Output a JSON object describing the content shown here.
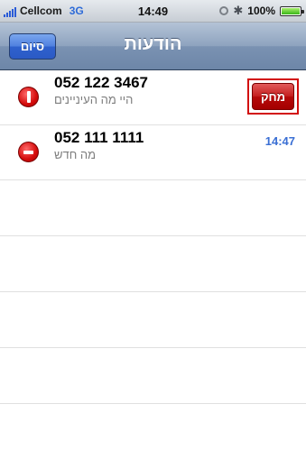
{
  "status_bar": {
    "carrier": "Cellcom",
    "network": "3G",
    "time": "14:49",
    "battery": "100%",
    "battery_level": 1.0,
    "icons": [
      "signal-icon",
      "lock-icon",
      "bluetooth-icon",
      "battery-icon"
    ]
  },
  "nav": {
    "title": "הודעות",
    "done_label": "סיום"
  },
  "messages": [
    {
      "sender": "052 122 3467",
      "preview": "היי מה העיניינים",
      "time": "",
      "delete_label": "מחק",
      "delete_icon_state": "rotated",
      "showing_delete": true
    },
    {
      "sender": "052 111 1111",
      "preview": "מה חדש",
      "time": "14:47",
      "delete_icon_state": "normal",
      "showing_delete": false
    }
  ],
  "colors": {
    "nav_bar": "#7a92b2",
    "done_button": "#2f61cd",
    "delete_button": "#c41e1e",
    "time_text": "#3a6fd4",
    "highlight_border": "#d20e0e"
  }
}
